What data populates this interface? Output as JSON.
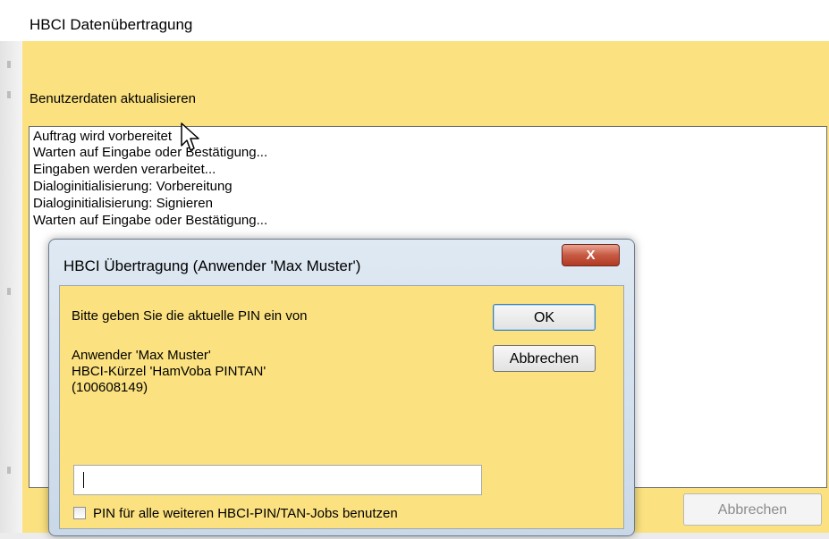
{
  "window": {
    "title": "HBCI Datenübertragung"
  },
  "main": {
    "section_label": "Benutzerdaten aktualisieren",
    "log": [
      "Auftrag wird vorbereitet",
      "Warten auf Eingabe oder Bestätigung...",
      "Eingaben werden verarbeitet...",
      "Dialoginitialisierung: Vorbereitung",
      "Dialoginitialisierung: Signieren",
      "Warten auf Eingabe oder Bestätigung..."
    ],
    "cancel_label": "Abbrechen"
  },
  "dialog": {
    "title": "HBCI Übertragung (Anwender 'Max Muster')",
    "close_label": "X",
    "prompt": "Bitte geben Sie die aktuelle PIN ein von",
    "info": [
      "Anwender 'Max Muster'",
      "HBCI-Kürzel 'HamVoba PINTAN'",
      "(100608149)"
    ],
    "ok_label": "OK",
    "cancel_label": "Abbrechen",
    "pin_value": "",
    "checkbox_label": "PIN für alle weiteren HBCI-PIN/TAN-Jobs benutzen",
    "checkbox_checked": false
  },
  "colors": {
    "panel_yellow": "#fbe17f",
    "close_red": "#c75a43",
    "dialog_frame": "#c9d8e8"
  },
  "icons": {
    "cursor": "arrow-cursor-icon",
    "close": "close-icon"
  }
}
